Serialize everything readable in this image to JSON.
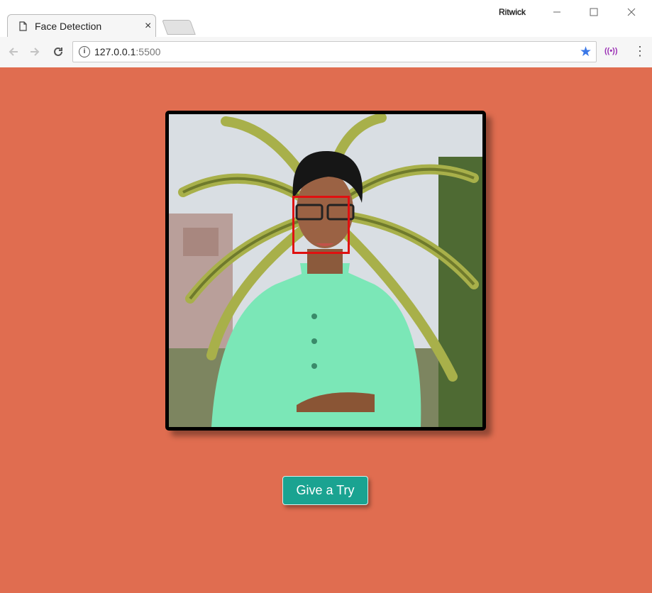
{
  "browser": {
    "tab_title": "Face Detection",
    "tab_close": "×",
    "profile_name": "Ritwick",
    "url_host": "127.0.0.1",
    "url_port": ":5500",
    "icons": [
      "page-icon",
      "back-icon",
      "forward-icon",
      "reload-icon",
      "info-icon",
      "star-icon",
      "cast-extension-icon",
      "menu-icon",
      "minimize-icon",
      "maximize-icon",
      "close-icon"
    ]
  },
  "page": {
    "button_label": "Give a Try",
    "background_color": "#e06d50",
    "button_color": "#1aa391",
    "face_box_color": "#e01010"
  }
}
